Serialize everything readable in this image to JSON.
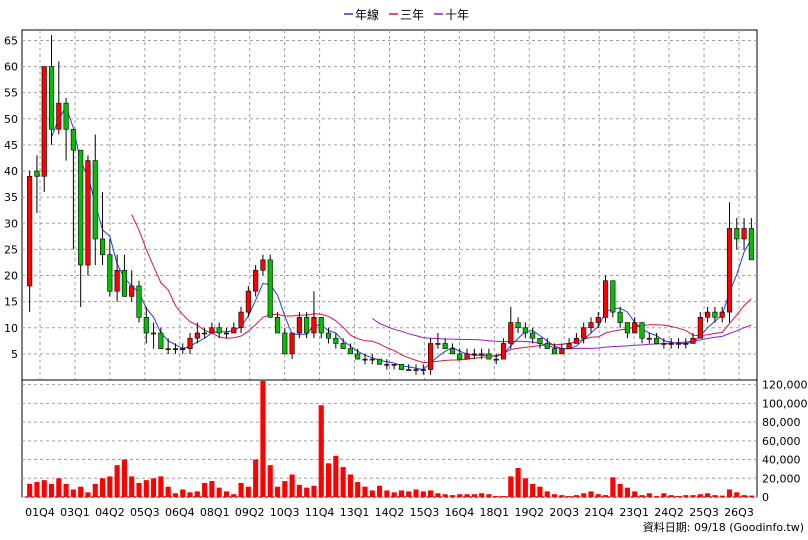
{
  "chart_data": [
    {
      "type": "candlestick",
      "legend": [
        {
          "name": "年線",
          "color": "#1f3fd8"
        },
        {
          "name": "三年",
          "color": "#d01848"
        },
        {
          "name": "十年",
          "color": "#9020c0"
        }
      ],
      "ylim": [
        0,
        67
      ],
      "y_ticks": [
        5,
        10,
        15,
        20,
        25,
        30,
        35,
        40,
        45,
        50,
        55,
        60,
        65
      ],
      "x_tick_labels": [
        "01Q4",
        "03Q1",
        "04Q2",
        "05Q3",
        "06Q4",
        "08Q1",
        "09Q2",
        "10Q3",
        "11Q4",
        "13Q1",
        "14Q2",
        "15Q3",
        "16Q4",
        "18Q1",
        "19Q2",
        "20Q3",
        "21Q4",
        "23Q1",
        "24Q2",
        "25Q3",
        "26Q3"
      ],
      "up_color": "#ff0000",
      "down_color": "#00c000",
      "ohlc": [
        [
          18,
          40,
          13,
          39
        ],
        [
          40,
          43,
          32,
          39
        ],
        [
          39,
          60,
          36,
          60
        ],
        [
          60,
          66,
          45,
          48
        ],
        [
          48,
          61,
          47,
          53
        ],
        [
          53,
          54,
          42,
          48
        ],
        [
          48,
          48,
          25,
          44
        ],
        [
          44,
          44,
          14,
          22
        ],
        [
          22,
          43,
          20,
          42
        ],
        [
          42,
          47,
          22,
          27
        ],
        [
          27,
          36,
          22,
          24
        ],
        [
          24,
          27,
          16,
          17
        ],
        [
          17,
          24,
          15,
          21
        ],
        [
          21,
          24,
          16,
          16
        ],
        [
          16,
          21,
          15,
          18
        ],
        [
          18,
          19,
          11,
          12
        ],
        [
          12,
          14,
          7,
          9
        ],
        [
          9,
          11,
          6,
          9
        ],
        [
          9,
          10,
          6,
          6
        ],
        [
          6,
          8,
          5,
          6
        ],
        [
          6,
          7,
          5,
          6
        ],
        [
          6,
          7,
          5,
          6
        ],
        [
          6,
          9,
          5,
          8
        ],
        [
          8,
          11,
          7,
          9
        ],
        [
          9,
          10,
          8,
          9
        ],
        [
          9,
          11,
          9,
          10
        ],
        [
          10,
          11,
          8,
          9
        ],
        [
          9,
          10,
          8,
          9
        ],
        [
          9,
          11,
          9,
          10
        ],
        [
          10,
          14,
          9,
          13
        ],
        [
          13,
          18,
          12,
          17
        ],
        [
          17,
          22,
          16,
          21
        ],
        [
          21,
          24,
          20,
          23
        ],
        [
          23,
          24,
          12,
          12
        ],
        [
          12,
          13,
          9,
          9
        ],
        [
          9,
          10,
          5,
          5
        ],
        [
          5,
          9,
          4,
          9
        ],
        [
          9,
          13,
          8,
          12
        ],
        [
          12,
          13,
          8,
          9
        ],
        [
          9,
          17,
          8,
          12
        ],
        [
          12,
          12,
          8,
          9
        ],
        [
          9,
          10,
          7,
          8
        ],
        [
          8,
          9,
          6,
          7
        ],
        [
          7,
          8,
          6,
          6
        ],
        [
          6,
          7,
          5,
          5
        ],
        [
          5,
          6,
          4,
          4
        ],
        [
          4,
          5,
          3,
          4
        ],
        [
          4,
          5,
          3,
          4
        ],
        [
          4,
          4,
          3,
          3
        ],
        [
          3,
          4,
          2,
          3
        ],
        [
          3,
          3,
          2,
          3
        ],
        [
          3,
          3,
          2,
          2
        ],
        [
          2,
          3,
          2,
          2
        ],
        [
          2,
          3,
          1,
          2
        ],
        [
          2,
          3,
          1,
          2
        ],
        [
          2,
          8,
          1,
          7
        ],
        [
          7,
          9,
          6,
          7
        ],
        [
          7,
          8,
          6,
          6
        ],
        [
          6,
          7,
          5,
          5
        ],
        [
          5,
          6,
          4,
          4
        ],
        [
          4,
          6,
          4,
          5
        ],
        [
          5,
          6,
          4,
          5
        ],
        [
          5,
          6,
          4,
          5
        ],
        [
          5,
          6,
          4,
          4
        ],
        [
          4,
          5,
          3,
          4
        ],
        [
          4,
          8,
          4,
          7
        ],
        [
          7,
          14,
          6,
          11
        ],
        [
          11,
          12,
          9,
          10
        ],
        [
          10,
          11,
          8,
          9
        ],
        [
          9,
          10,
          7,
          8
        ],
        [
          8,
          8,
          6,
          7
        ],
        [
          7,
          8,
          6,
          6
        ],
        [
          6,
          7,
          5,
          5
        ],
        [
          5,
          7,
          5,
          6
        ],
        [
          6,
          8,
          6,
          7
        ],
        [
          7,
          9,
          7,
          8
        ],
        [
          8,
          11,
          7,
          10
        ],
        [
          10,
          12,
          9,
          11
        ],
        [
          11,
          13,
          10,
          12
        ],
        [
          12,
          20,
          11,
          19
        ],
        [
          19,
          19,
          12,
          13
        ],
        [
          13,
          14,
          10,
          11
        ],
        [
          11,
          11,
          8,
          9
        ],
        [
          9,
          12,
          9,
          11
        ],
        [
          11,
          11,
          7,
          8
        ],
        [
          8,
          9,
          7,
          8
        ],
        [
          8,
          9,
          7,
          7
        ],
        [
          7,
          8,
          6,
          7
        ],
        [
          7,
          8,
          6,
          7
        ],
        [
          7,
          8,
          6,
          7
        ],
        [
          7,
          8,
          6,
          7
        ],
        [
          7,
          9,
          7,
          8
        ],
        [
          8,
          13,
          8,
          12
        ],
        [
          12,
          14,
          11,
          13
        ],
        [
          13,
          14,
          11,
          12
        ],
        [
          12,
          14,
          11,
          13
        ],
        [
          13,
          34,
          11,
          29
        ],
        [
          29,
          31,
          25,
          27
        ],
        [
          27,
          31,
          25,
          29
        ],
        [
          29,
          31,
          23,
          23
        ]
      ],
      "volume": {
        "ylim": [
          0,
          125000
        ],
        "y_ticks": [
          0,
          20000,
          40000,
          60000,
          80000,
          100000,
          120000
        ],
        "y_tick_labels": [
          "0",
          "20,000",
          "40,000",
          "60,000",
          "80,000",
          "100,000",
          "120,000"
        ],
        "values": [
          14000,
          16000,
          18000,
          14000,
          20000,
          14000,
          8000,
          11000,
          5000,
          14000,
          20000,
          22000,
          34000,
          40000,
          22000,
          15000,
          18000,
          20000,
          22000,
          11000,
          4000,
          8000,
          5000,
          6000,
          15000,
          17000,
          10000,
          6000,
          3000,
          15000,
          11000,
          40000,
          124000,
          34000,
          11000,
          17000,
          24000,
          13000,
          10000,
          12000,
          98000,
          36000,
          44000,
          32000,
          24000,
          16000,
          11000,
          7000,
          12000,
          7000,
          5000,
          7000,
          6000,
          8000,
          6000,
          7000,
          4000,
          3000,
          2000,
          3000,
          3000,
          3000,
          4000,
          3000,
          1000,
          1000,
          22000,
          31000,
          20000,
          14000,
          11000,
          6000,
          3000,
          2000,
          1000,
          2000,
          4000,
          6000,
          3000,
          2000,
          21000,
          14000,
          10000,
          6000,
          2000,
          4000,
          1000,
          4000,
          2000,
          1000,
          2000,
          2000,
          3000,
          4000,
          2000,
          1500,
          8000,
          5000,
          2000,
          1500
        ]
      },
      "source_label": "資料日期: 09/18  (Goodinfo.tw)"
    }
  ]
}
